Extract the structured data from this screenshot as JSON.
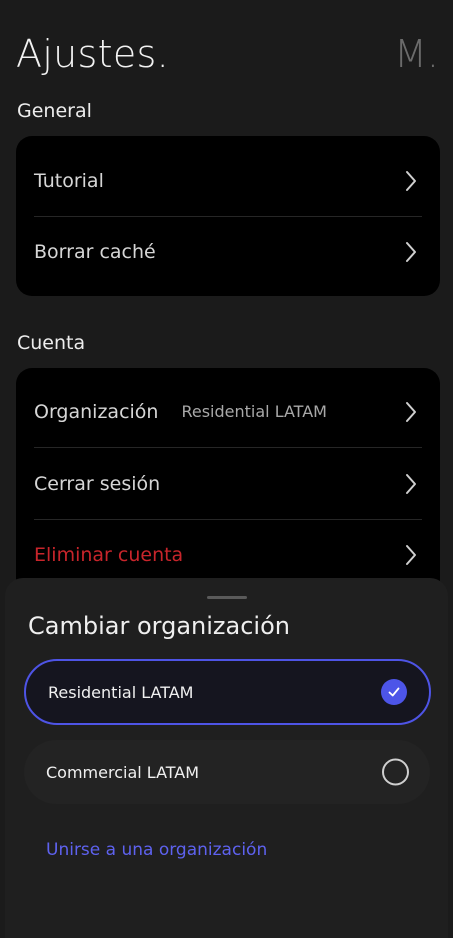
{
  "header": {
    "title": "Ajustes.",
    "avatar_initial": "M."
  },
  "general": {
    "label": "General",
    "items": [
      {
        "label": "Tutorial"
      },
      {
        "label": "Borrar caché"
      }
    ]
  },
  "account": {
    "label": "Cuenta",
    "items": [
      {
        "label": "Organización",
        "value": "Residential LATAM"
      },
      {
        "label": "Cerrar sesión"
      },
      {
        "label": "Eliminar cuenta"
      }
    ]
  },
  "sheet": {
    "title": "Cambiar organización",
    "options": [
      {
        "label": "Residential LATAM",
        "selected": true
      },
      {
        "label": "Commercial LATAM",
        "selected": false
      }
    ],
    "join_label": "Unirse a una organización"
  },
  "colors": {
    "accent": "#4d55e8",
    "danger": "#c8252b",
    "link": "#5e62ef"
  },
  "icons": {
    "row_chevron": "chevron-right-icon",
    "selected": "check-icon",
    "unselected": "radio-icon"
  }
}
